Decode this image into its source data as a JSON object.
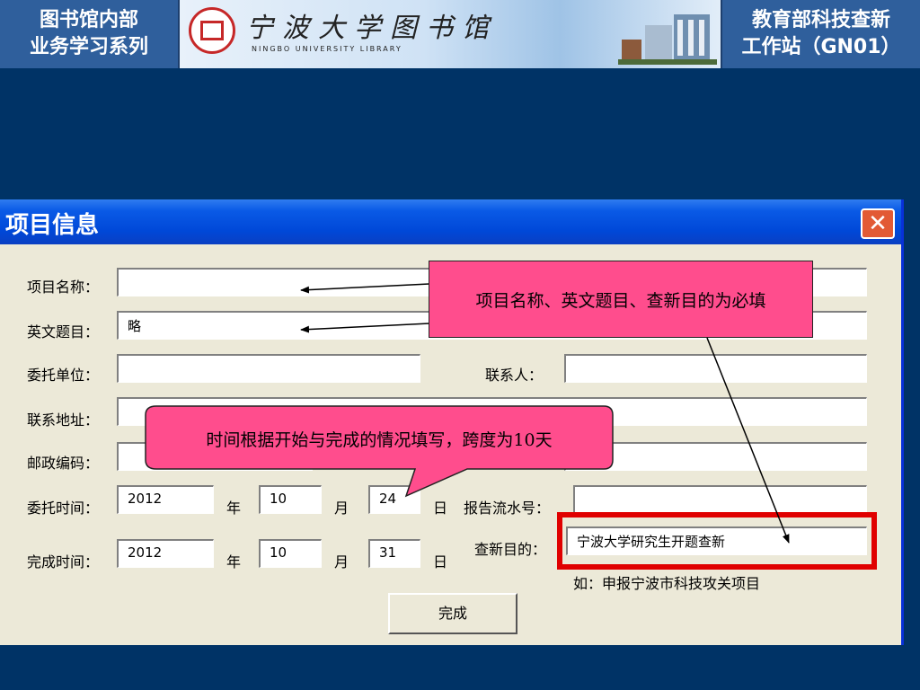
{
  "banner": {
    "left_line1": "图书馆内部",
    "left_line2": "业务学习系列",
    "library_cn": "宁波大学图书馆",
    "library_en": "NINGBO UNIVERSITY LIBRARY",
    "right_line1": "教育部科技查新",
    "right_line2": "工作站（GN01）"
  },
  "dialog": {
    "title": "项目信息",
    "close_symbol": "✕",
    "labels": {
      "project_name": "项目名称：",
      "english_title": "英文题目：",
      "client_unit": "委托单位：",
      "contact_person": "联系人：",
      "contact_address": "联系地址：",
      "postal_code": "邮政编码：",
      "commission_time": "委托时间：",
      "report_serial": "报告流水号：",
      "completion_time": "完成时间：",
      "purpose": "查新目的："
    },
    "values": {
      "project_name": "",
      "english_title": "略",
      "client_unit": "",
      "contact_person": "",
      "contact_address": "",
      "postal_code": "",
      "phone": "",
      "report_serial": "",
      "commission_year": "2012",
      "commission_month": "10",
      "commission_day": "24",
      "completion_year": "2012",
      "completion_month": "10",
      "completion_day": "31",
      "purpose": "宁波大学研究生开题查新"
    },
    "units": {
      "year": "年",
      "month": "月",
      "day": "日"
    },
    "purpose_hint": "如：申报宁波市科技攻关项目",
    "done_label": "完成"
  },
  "annotations": {
    "required_note": "项目名称、英文题目、查新目的为必填",
    "time_note": "时间根据开始与完成的情况填写，跨度为10天"
  },
  "colors": {
    "background": "#003366",
    "callout": "#ff4d8d",
    "highlight_box": "#e00000"
  }
}
